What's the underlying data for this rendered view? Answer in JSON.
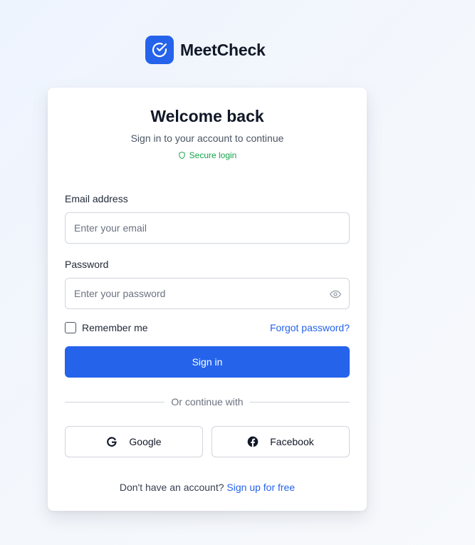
{
  "brand": {
    "name": "MeetCheck",
    "logo_icon": "check-circle-icon",
    "color": "#2563eb"
  },
  "card": {
    "title": "Welcome back",
    "subtitle": "Sign in to your account to continue",
    "secure_label": "Secure login"
  },
  "form": {
    "email": {
      "label": "Email address",
      "placeholder": "Enter your email",
      "value": ""
    },
    "password": {
      "label": "Password",
      "placeholder": "Enter your password",
      "value": "",
      "toggle_icon": "eye-icon"
    },
    "remember_label": "Remember me",
    "remember_checked": false,
    "forgot_label": "Forgot password?",
    "submit_label": "Sign in"
  },
  "divider_text": "Or continue with",
  "social": {
    "google_label": "Google",
    "facebook_label": "Facebook"
  },
  "footer": {
    "prompt": "Don't have an account?",
    "signup_label": "Sign up for free"
  },
  "colors": {
    "primary": "#2563eb",
    "secure": "#16a34a",
    "border": "#d1d5db"
  }
}
